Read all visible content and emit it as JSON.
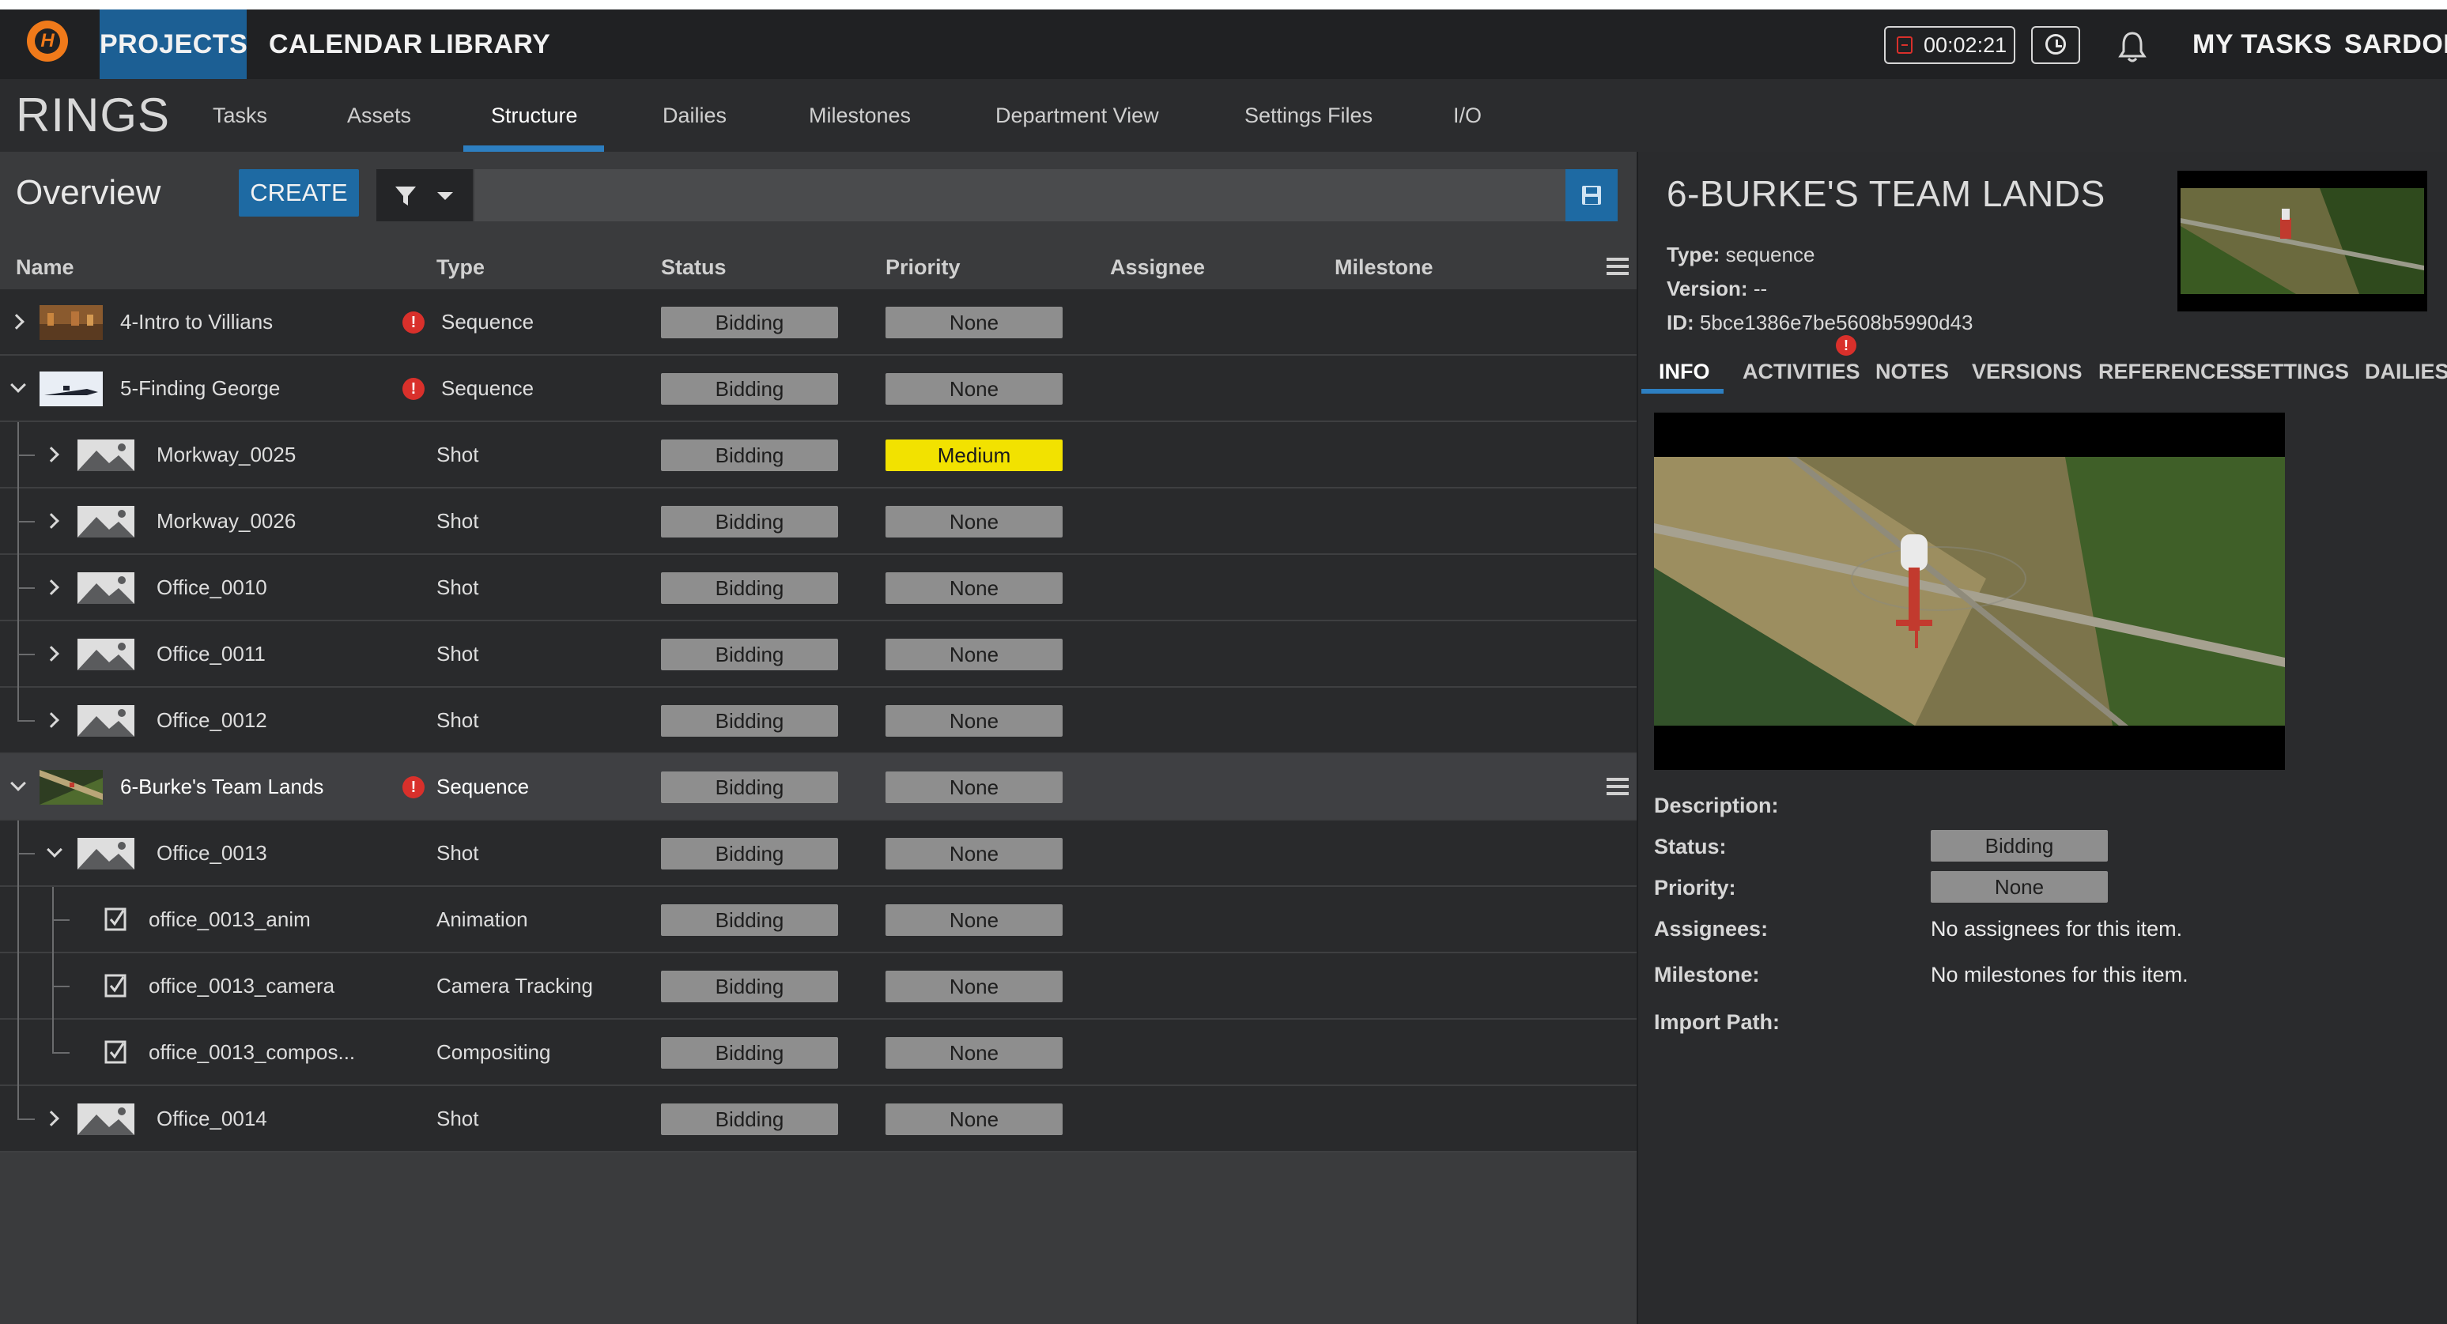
{
  "topnav": {
    "logo_letter": "H",
    "items": [
      "PROJECTS",
      "CALENDAR",
      "LIBRARY"
    ],
    "timer": "00:02:21",
    "my_tasks": "MY TASKS",
    "user": "SARDOR"
  },
  "project": {
    "title": "RINGS",
    "tabs": [
      "Tasks",
      "Assets",
      "Structure",
      "Dailies",
      "Milestones",
      "Department View",
      "Settings Files",
      "I/O"
    ],
    "active_tab": "Structure"
  },
  "overview": {
    "title": "Overview",
    "create_label": "CREATE",
    "search_placeholder": ""
  },
  "table": {
    "columns": [
      "Name",
      "Type",
      "Status",
      "Priority",
      "Assignee",
      "Milestone"
    ],
    "rows": [
      {
        "name": "4-Intro to Villians",
        "type": "Sequence",
        "status": "Bidding",
        "priority": "None"
      },
      {
        "name": "5-Finding George",
        "type": "Sequence",
        "status": "Bidding",
        "priority": "None"
      },
      {
        "name": "Morkway_0025",
        "type": "Shot",
        "status": "Bidding",
        "priority": "Medium"
      },
      {
        "name": "Morkway_0026",
        "type": "Shot",
        "status": "Bidding",
        "priority": "None"
      },
      {
        "name": "Office_0010",
        "type": "Shot",
        "status": "Bidding",
        "priority": "None"
      },
      {
        "name": "Office_0011",
        "type": "Shot",
        "status": "Bidding",
        "priority": "None"
      },
      {
        "name": "Office_0012",
        "type": "Shot",
        "status": "Bidding",
        "priority": "None"
      },
      {
        "name": "6-Burke's Team Lands",
        "type": "Sequence",
        "status": "Bidding",
        "priority": "None"
      },
      {
        "name": "Office_0013",
        "type": "Shot",
        "status": "Bidding",
        "priority": "None"
      },
      {
        "name": "office_0013_anim",
        "type": "Animation",
        "status": "Bidding",
        "priority": "None"
      },
      {
        "name": "office_0013_camera",
        "type": "Camera Tracking",
        "status": "Bidding",
        "priority": "None"
      },
      {
        "name": "office_0013_compos...",
        "type": "Compositing",
        "status": "Bidding",
        "priority": "None"
      },
      {
        "name": "Office_0014",
        "type": "Shot",
        "status": "Bidding",
        "priority": "None"
      }
    ]
  },
  "detail": {
    "title": "6-BURKE'S TEAM LANDS",
    "type_label": "Type:",
    "type_value": "sequence",
    "version_label": "Version:",
    "version_value": "--",
    "id_label": "ID:",
    "id_value": "5bce1386e7be5608b5990d43",
    "tabs": [
      "INFO",
      "ACTIVITIES",
      "NOTES",
      "VERSIONS",
      "REFERENCES",
      "SETTINGS",
      "DAILIES"
    ],
    "alert_glyph": "!",
    "info": {
      "description_label": "Description:",
      "status_label": "Status:",
      "status_value": "Bidding",
      "priority_label": "Priority:",
      "priority_value": "None",
      "assignees_label": "Assignees:",
      "assignees_value": "No assignees for this item.",
      "milestone_label": "Milestone:",
      "milestone_value": "No milestones for this item.",
      "import_path_label": "Import Path:"
    }
  },
  "colors": {
    "accent": "#1e6aa3",
    "tab_underline": "#2d7fc1",
    "alert": "#d9302b",
    "medium_priority": "#f2e200",
    "logo": "#f07a1a"
  }
}
